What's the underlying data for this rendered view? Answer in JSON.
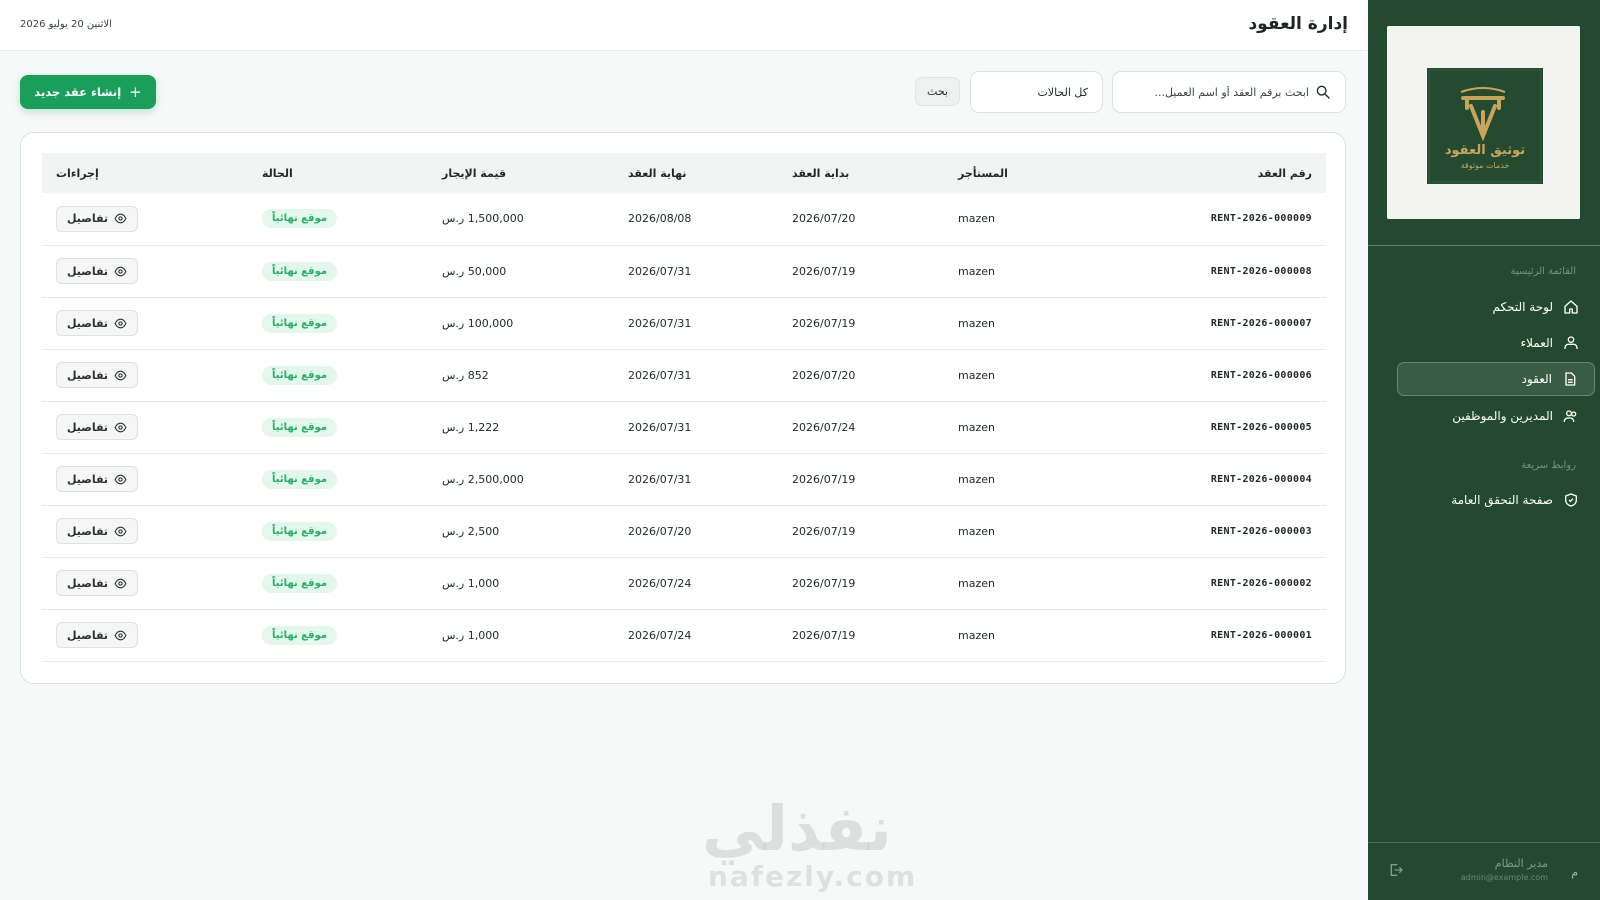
{
  "header": {
    "title": "إدارة العقود",
    "date": "الاثنين 20 يوليو 2026"
  },
  "sidebar": {
    "logo": {
      "title": "توثيق العقود",
      "subtitle": "خدمات موثوقة"
    },
    "sections": [
      {
        "title": "القائمة الرئيسية"
      },
      {
        "title": "روابط سريعة"
      }
    ],
    "items": [
      {
        "label": "لوحة التحكم",
        "icon": "home-icon",
        "active": false
      },
      {
        "label": "العملاء",
        "icon": "clients-icon",
        "active": false
      },
      {
        "label": "العقود",
        "icon": "document-icon",
        "active": true
      },
      {
        "label": "المديرين والموظفين",
        "icon": "users-icon",
        "active": false
      },
      {
        "label": "صفحة التحقق العامة",
        "icon": "shield-check-icon",
        "active": false
      }
    ],
    "user": {
      "name": "مدير النظام",
      "email": "admin@example.com",
      "initial": "م"
    }
  },
  "toolbar": {
    "search_placeholder": "ابحث برقم العقد أو اسم العميل...",
    "status_select": "كل الحالات",
    "search_button": "بحث",
    "create_button": "إنشاء عقد جديد"
  },
  "table": {
    "columns": [
      "رقم العقد",
      "المستأجر",
      "بداية العقد",
      "نهاية العقد",
      "قيمة الإيجار",
      "الحالة",
      "إجراءات"
    ],
    "details_label": "تفاصيل",
    "rows": [
      {
        "number": "RENT-2026-000009",
        "tenant": "mazen",
        "start": "2026/07/20",
        "end": "2026/08/08",
        "rent": "1,500,000 ر.س",
        "status": "موقع نهائياً"
      },
      {
        "number": "RENT-2026-000008",
        "tenant": "mazen",
        "start": "2026/07/19",
        "end": "2026/07/31",
        "rent": "50,000 ر.س",
        "status": "موقع نهائياً"
      },
      {
        "number": "RENT-2026-000007",
        "tenant": "mazen",
        "start": "2026/07/19",
        "end": "2026/07/31",
        "rent": "100,000 ر.س",
        "status": "موقع نهائياً"
      },
      {
        "number": "RENT-2026-000006",
        "tenant": "mazen",
        "start": "2026/07/20",
        "end": "2026/07/31",
        "rent": "852 ر.س",
        "status": "موقع نهائياً"
      },
      {
        "number": "RENT-2026-000005",
        "tenant": "mazen",
        "start": "2026/07/24",
        "end": "2026/07/31",
        "rent": "1,222 ر.س",
        "status": "موقع نهائياً"
      },
      {
        "number": "RENT-2026-000004",
        "tenant": "mazen",
        "start": "2026/07/19",
        "end": "2026/07/31",
        "rent": "2,500,000 ر.س",
        "status": "موقع نهائياً"
      },
      {
        "number": "RENT-2026-000003",
        "tenant": "mazen",
        "start": "2026/07/19",
        "end": "2026/07/20",
        "rent": "2,500 ر.س",
        "status": "موقع نهائياً"
      },
      {
        "number": "RENT-2026-000002",
        "tenant": "mazen",
        "start": "2026/07/19",
        "end": "2026/07/24",
        "rent": "1,000 ر.س",
        "status": "موقع نهائياً"
      },
      {
        "number": "RENT-2026-000001",
        "tenant": "mazen",
        "start": "2026/07/19",
        "end": "2026/07/24",
        "rent": "1,000 ر.س",
        "status": "موقع نهائياً"
      }
    ]
  },
  "watermark": {
    "arabic": "نفذلي",
    "latin": "nafezly.com"
  },
  "colors": {
    "sidebar": "#234a2f",
    "accent": "#1a9f5b",
    "badge_bg": "#e3f7ec",
    "badge_text": "#25b06a"
  }
}
